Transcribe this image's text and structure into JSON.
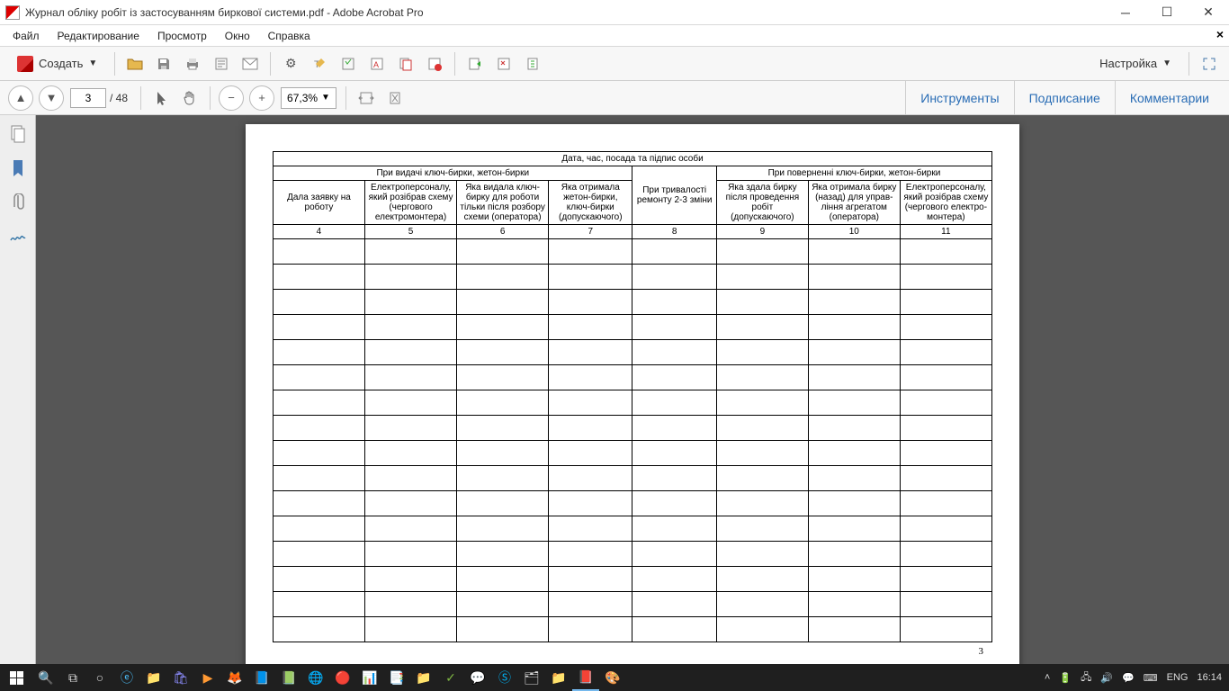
{
  "window": {
    "title": "Журнал обліку робіт із застосуванням биркової системи.pdf - Adobe Acrobat Pro"
  },
  "menu": {
    "file": "Файл",
    "edit": "Редактирование",
    "view": "Просмотр",
    "window": "Окно",
    "help": "Справка"
  },
  "toolbar": {
    "create": "Создать",
    "configure": "Настройка"
  },
  "nav": {
    "page": "3",
    "total": "/ 48",
    "zoom": "67,3%"
  },
  "panels": {
    "tools": "Инструменты",
    "sign": "Подписание",
    "comments": "Комментарии"
  },
  "doc": {
    "header_top": "Дата, час, посада та підпис особи",
    "group_issue": "При видачі ключ-бирки, жетон-бирки",
    "group_return": "При поверненні ключ-бирки, жетон-бирки",
    "h4": "Дала заявку на роботу",
    "h5": "Електроперсоналу, який розібрав схему (чергового електромонтера)",
    "h6": "Яка видала ключ-бирку для роботи тільки після розбору схеми (оператора)",
    "h7": "Яка отримала жетон-бирки, ключ-бирки (допускаючого)",
    "h8": "При тривалості ремонту 2-3 зміни",
    "h9": "Яка здала бирку після проведення робіт (допускаючого)",
    "h10": "Яка отримала бирку (назад) для управ-ління агрегатом (оператора)",
    "h11": "Електроперсоналу, який розібрав схему (чергового електро-монтера)",
    "n4": "4",
    "n5": "5",
    "n6": "6",
    "n7": "7",
    "n8": "8",
    "n9": "9",
    "n10": "10",
    "n11": "11",
    "page_number": "3"
  },
  "system": {
    "lang": "ENG",
    "time": "16:14"
  }
}
